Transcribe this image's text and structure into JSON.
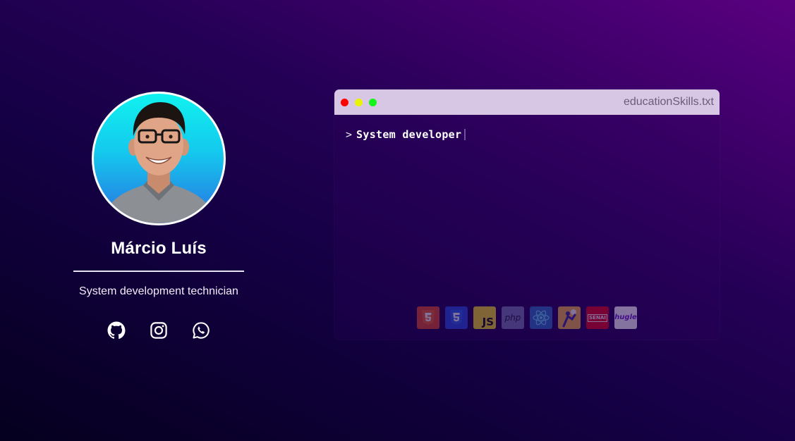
{
  "profile": {
    "name": "Márcio Luís",
    "role": "System development technician",
    "avatar_icon": "profile-photo"
  },
  "socials": [
    {
      "icon": "github-icon"
    },
    {
      "icon": "instagram-icon"
    },
    {
      "icon": "whatsapp-icon"
    }
  ],
  "terminal": {
    "title": "educationSkills.txt",
    "prompt": ">",
    "typed_text": "System developer",
    "buttons": [
      {
        "icon": "close-dot",
        "color": "#ff0000"
      },
      {
        "icon": "minimize-dot",
        "color": "#e9f500"
      },
      {
        "icon": "maximize-dot",
        "color": "#14f51b"
      }
    ]
  },
  "skills": [
    {
      "icon": "html5-icon",
      "color": "#e44d26"
    },
    {
      "icon": "css3-icon",
      "color": "#264de4"
    },
    {
      "icon": "javascript-icon",
      "label": "JS",
      "color": "#f7df1e"
    },
    {
      "icon": "php-icon",
      "label": "php",
      "color": "#777bb3"
    },
    {
      "icon": "react-icon",
      "color": "#61dafb"
    },
    {
      "icon": "skill-illustration-icon",
      "color": "#f4b942"
    },
    {
      "icon": "senai-icon",
      "label": "SENAI",
      "color": "#e30613"
    },
    {
      "icon": "hugle-icon",
      "label": "hugle",
      "color": "#ffffff"
    }
  ],
  "colors": {
    "background_start": "#05001e",
    "background_end": "#5a0080",
    "titlebar": "#d8c7e4",
    "accent_cyan": "#10f2ef"
  }
}
